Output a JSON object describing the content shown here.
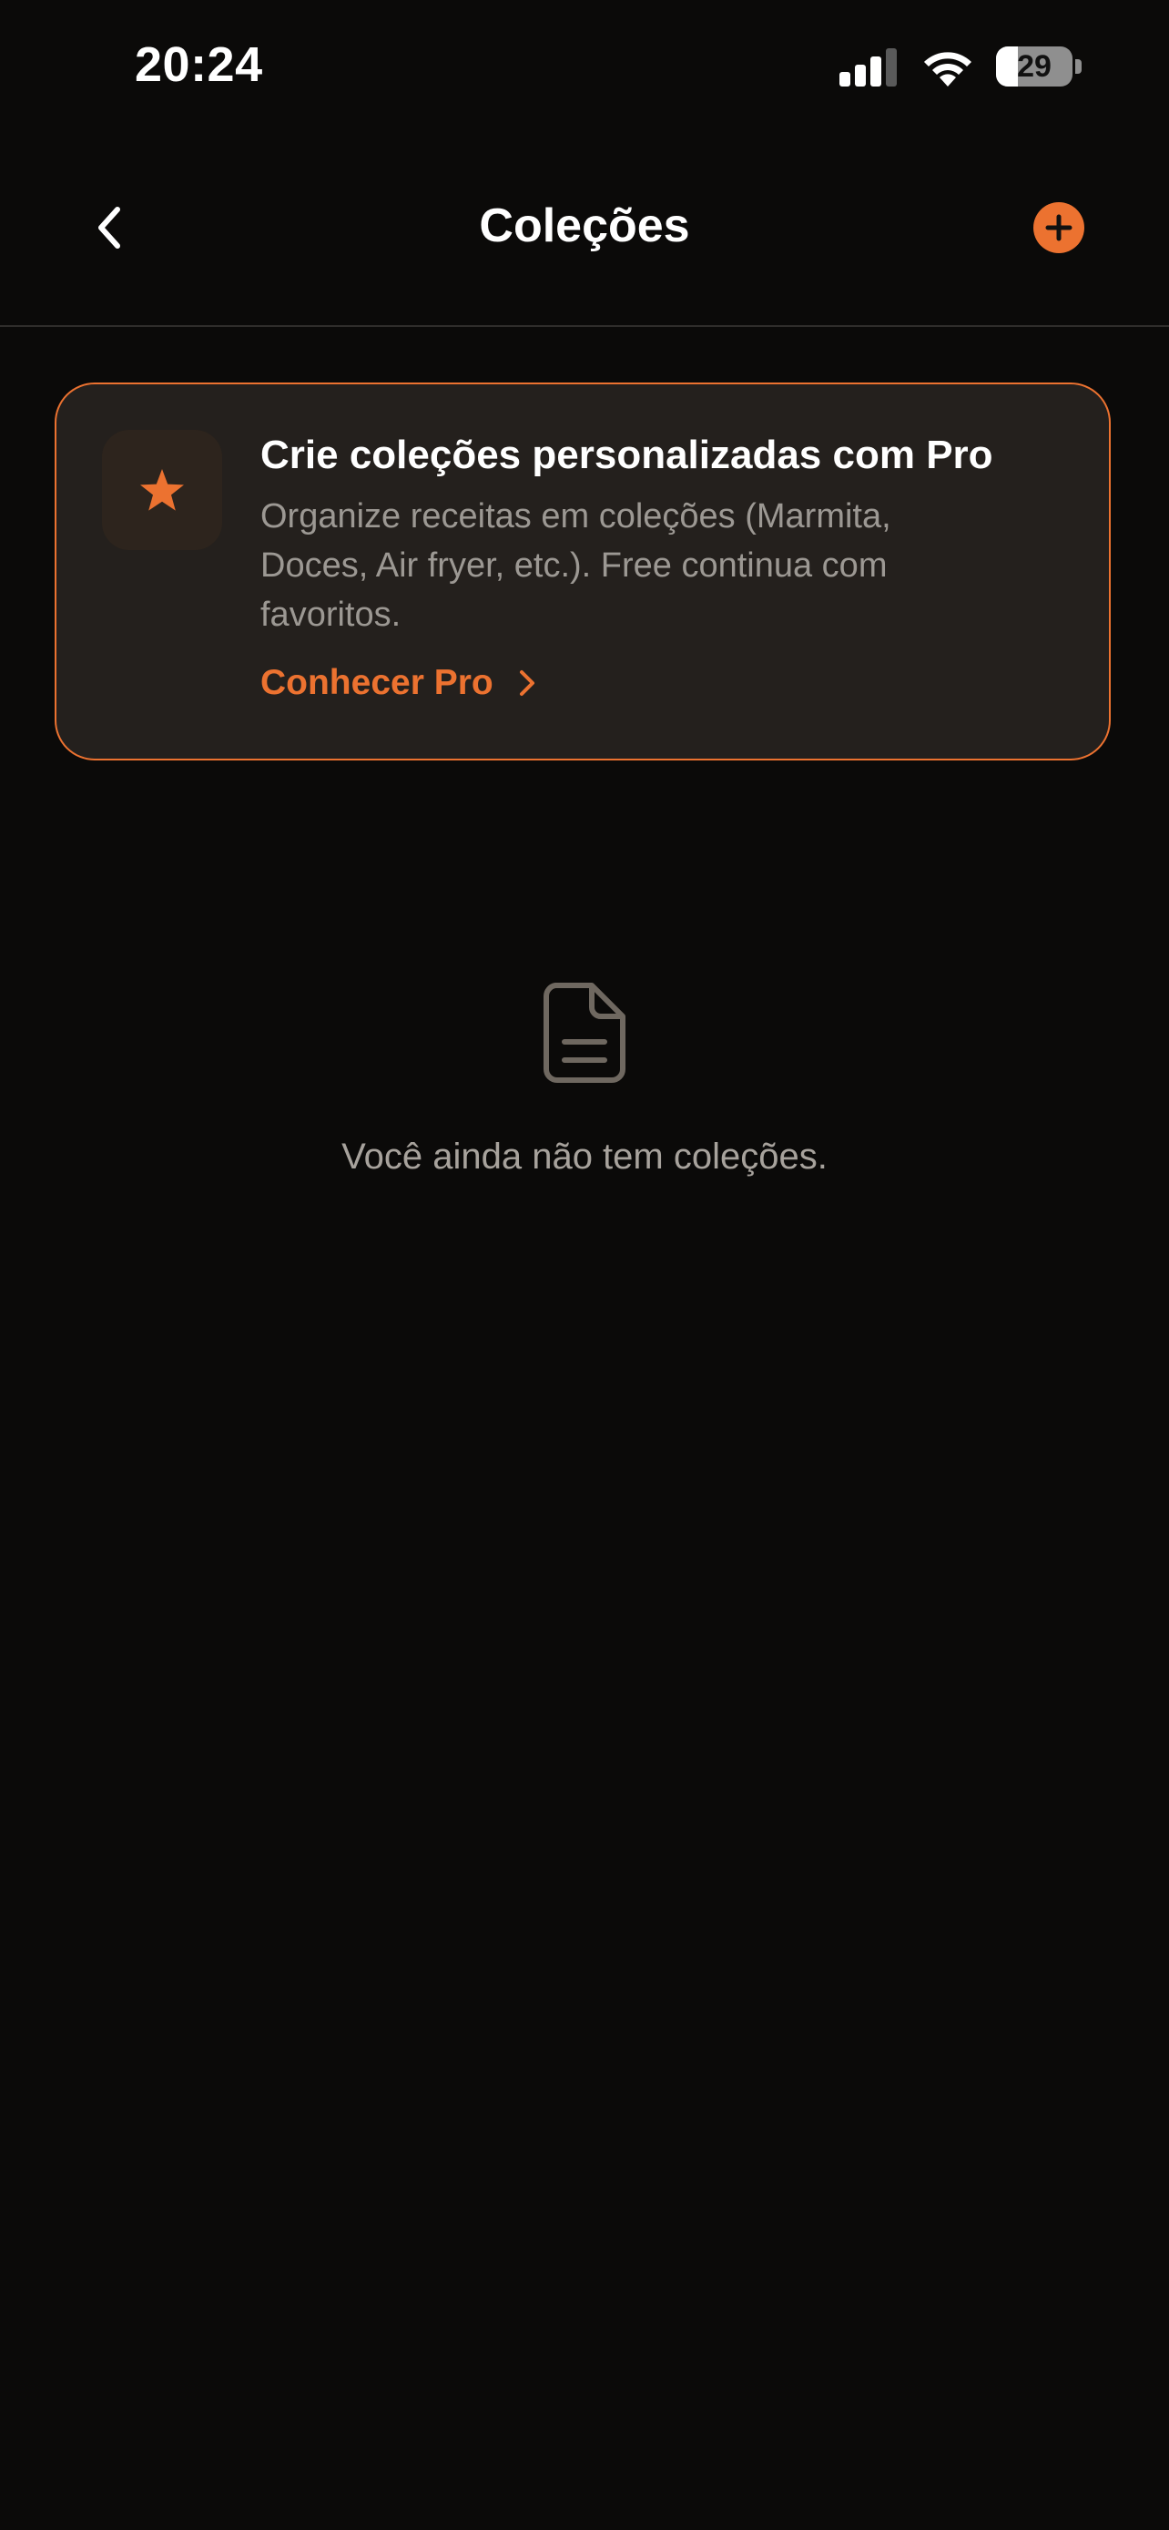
{
  "status_bar": {
    "time": "20:24",
    "battery_level": "29",
    "battery_fraction": 0.29,
    "icons": [
      "cellular-signal-icon",
      "wifi-icon",
      "battery-icon"
    ]
  },
  "nav": {
    "title": "Coleções",
    "back_icon": "chevron-left-icon",
    "add_icon": "plus-circle-icon"
  },
  "promo": {
    "icon": "star-icon",
    "title": "Crie coleções personalizadas com Pro",
    "description": "Organize receitas em coleções (Marmita, Doces, Air fryer, etc.). Free continua com favoritos.",
    "link_label": "Conhecer Pro",
    "link_icon": "chevron-right-icon"
  },
  "empty_state": {
    "icon": "document-icon",
    "message": "Você ainda não tem coleções."
  },
  "colors": {
    "background": "#0b0a09",
    "accent": "#ec7230",
    "card_background": "#24201d",
    "muted_text": "#9c9893"
  }
}
